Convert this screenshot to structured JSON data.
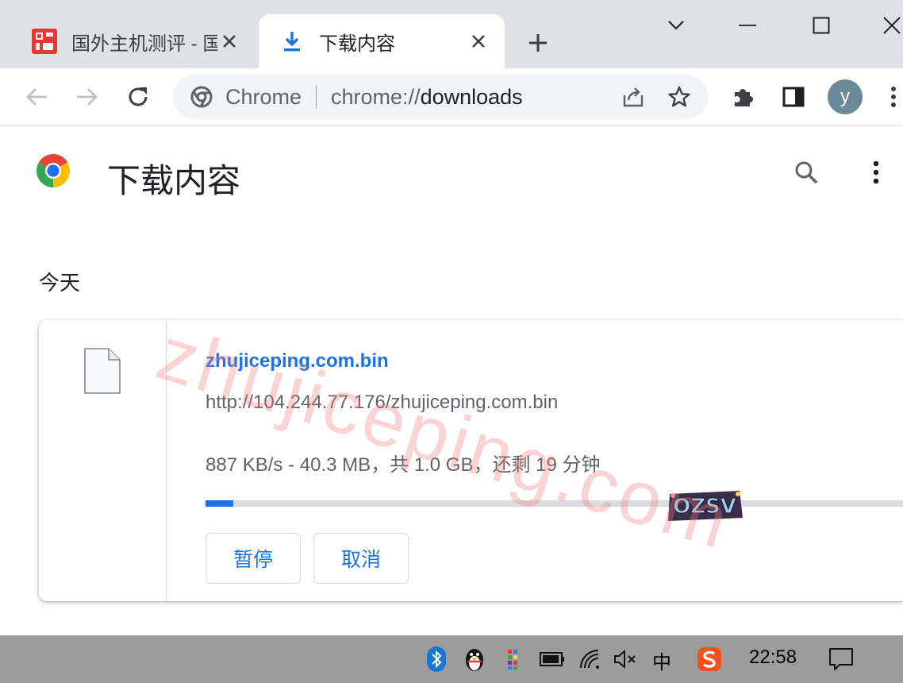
{
  "tabs": [
    {
      "title": "国外主机测评 - 国",
      "active": false
    },
    {
      "title": "下载内容",
      "active": true
    }
  ],
  "omnibox": {
    "site_name": "Chrome",
    "url_scheme": "chrome://",
    "url_path": "downloads"
  },
  "profile": {
    "initial": "y"
  },
  "page": {
    "title": "下载内容",
    "section": "今天"
  },
  "download": {
    "file_name": "zhujiceping.com.bin",
    "url": "http://104.244.77.176/zhujiceping.com.bin",
    "status": "887 KB/s - 40.3 MB，共 1.0 GB，还剩 19 分钟",
    "progress_fraction": 0.04,
    "pause_label": "暂停",
    "cancel_label": "取消"
  },
  "watermark": "zhujiceping.com",
  "sticker_text": "OZSV",
  "taskbar": {
    "ime": "中",
    "clock": "22:58"
  },
  "colors": {
    "accent": "#1a73e8",
    "tabstrip": "#dee1e6",
    "taskbar": "#9c9c9c"
  }
}
